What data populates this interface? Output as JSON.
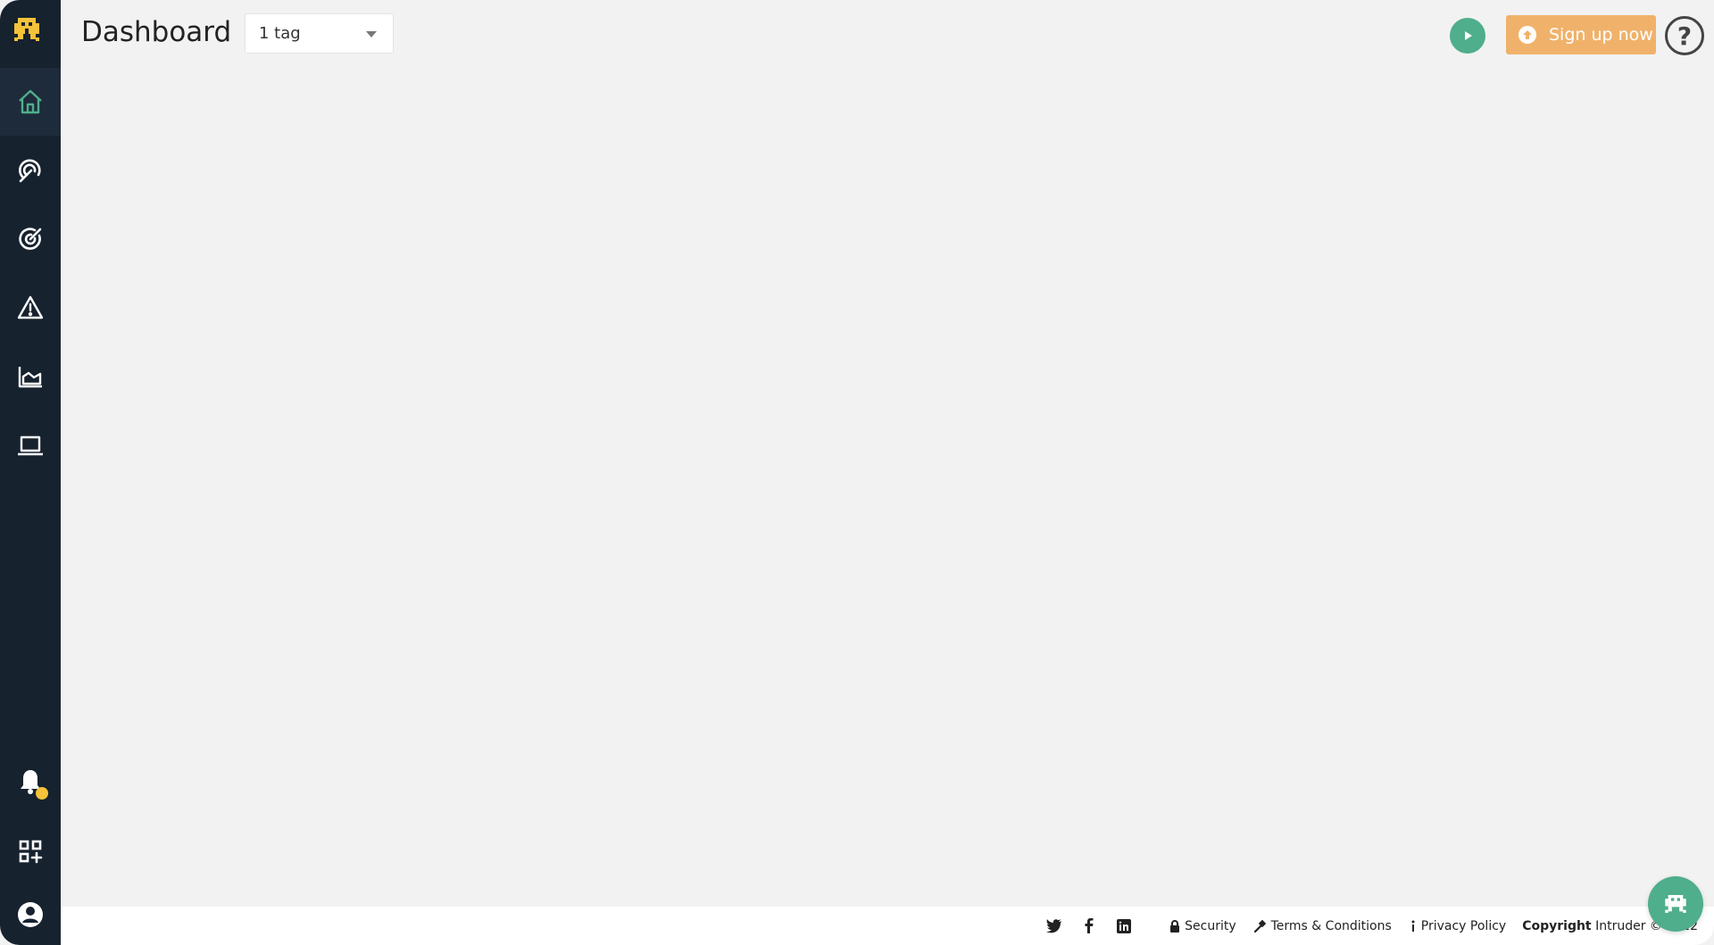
{
  "header": {
    "title": "Dashboard",
    "tag_filter": "1 tag",
    "signup_label": "Sign up now",
    "help_label": "?"
  },
  "sidebar": {
    "items": [
      {
        "name": "home-icon",
        "active": true
      },
      {
        "name": "radar-icon",
        "active": false
      },
      {
        "name": "target-icon",
        "active": false
      },
      {
        "name": "warning-icon",
        "active": false
      },
      {
        "name": "chart-icon",
        "active": false
      },
      {
        "name": "laptop-icon",
        "active": false
      },
      {
        "name": "bell-icon",
        "active": false
      },
      {
        "name": "integrations-icon",
        "active": false
      },
      {
        "name": "account-icon",
        "active": false
      }
    ]
  },
  "footer": {
    "security": "Security",
    "terms": "Terms & Conditions",
    "privacy": "Privacy Policy",
    "copyright_bold": "Copyright",
    "copyright_rest": "Intruder © 2022"
  },
  "colors": {
    "sidebar": "#17222f",
    "accent_green": "#4fae8b",
    "signup_orange": "#f0b26a",
    "notification_dot": "#f5c23a"
  }
}
